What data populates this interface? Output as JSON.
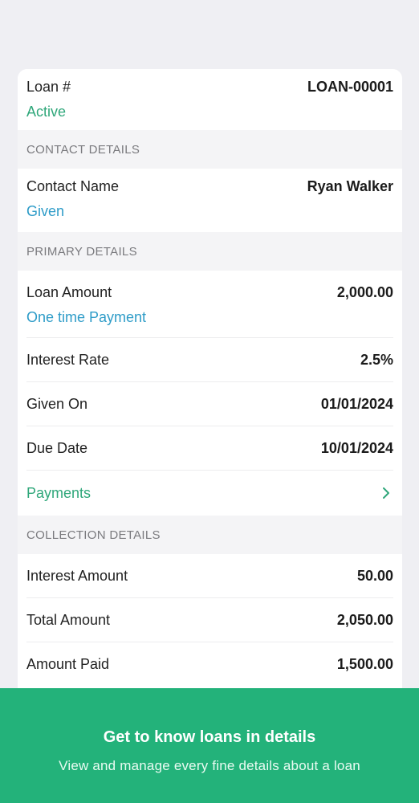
{
  "loan": {
    "label": "Loan #",
    "number": "LOAN-00001",
    "status": "Active"
  },
  "contact_section": {
    "header": "CONTACT DETAILS",
    "name_label": "Contact Name",
    "name_value": "Ryan Walker",
    "type": "Given"
  },
  "primary_section": {
    "header": "PRIMARY DETAILS",
    "amount_label": "Loan Amount",
    "amount_value": "2,000.00",
    "payment_type": "One time Payment",
    "interest_rate_label": "Interest Rate",
    "interest_rate_value": "2.5%",
    "given_on_label": "Given On",
    "given_on_value": "01/01/2024",
    "due_date_label": "Due Date",
    "due_date_value": "10/01/2024",
    "payments_label": "Payments",
    "payments_icon": "chevron-right-icon"
  },
  "collection_section": {
    "header": "COLLECTION DETAILS",
    "interest_amount_label": "Interest Amount",
    "interest_amount_value": "50.00",
    "total_amount_label": "Total Amount",
    "total_amount_value": "2,050.00",
    "amount_paid_label": "Amount Paid",
    "amount_paid_value": "1,500.00"
  },
  "banner": {
    "title": "Get to know loans in details",
    "subtitle": "View and manage every fine details about a loan"
  },
  "colors": {
    "accent_green": "#2fa77a",
    "accent_blue": "#2e9cc8",
    "banner_green": "#23b27a",
    "background": "#efeff3"
  }
}
